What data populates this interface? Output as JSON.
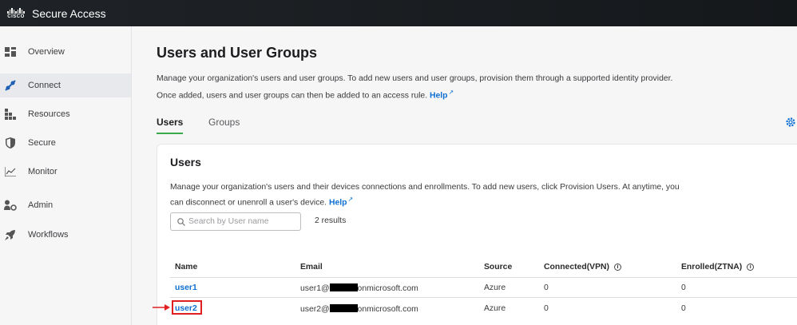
{
  "app": {
    "title": "Secure Access",
    "logo_text": "CISCO"
  },
  "sidebar": {
    "items": [
      {
        "label": "Overview",
        "icon": "overview-icon"
      },
      {
        "label": "Connect",
        "icon": "connect-icon",
        "active": true
      },
      {
        "label": "Resources",
        "icon": "resources-icon"
      },
      {
        "label": "Secure",
        "icon": "shield-icon"
      },
      {
        "label": "Monitor",
        "icon": "monitor-chart-icon"
      },
      {
        "label": "Admin",
        "icon": "admin-user-gear-icon"
      },
      {
        "label": "Workflows",
        "icon": "rocket-icon"
      }
    ]
  },
  "page": {
    "title": "Users and User Groups",
    "desc1": "Manage your organization's users and user groups. To add new users and user groups, provision them through a supported identity provider.",
    "desc2": "Once added, users and user groups can then be added to an access rule.",
    "help": "Help"
  },
  "tabs": [
    {
      "label": "Users",
      "active": true
    },
    {
      "label": "Groups",
      "active": false
    }
  ],
  "card": {
    "title": "Users",
    "desc1": "Manage your organization's users and their devices connections and enrollments. To add new users, click Provision Users. At anytime, you",
    "desc2": "can disconnect or unenroll a user's device.",
    "help": "Help",
    "search_placeholder": "Search by User name",
    "results": "2 results"
  },
  "table": {
    "headers": [
      "Name",
      "Email",
      "Source",
      "Connected(VPN)",
      "Enrolled(ZTNA)"
    ],
    "info_glyph": "i",
    "rows": [
      {
        "name": "user1",
        "email_prefix": "user1@",
        "email_suffix": "onmicrosoft.com",
        "source": "Azure",
        "connected": "0",
        "enrolled": "0"
      },
      {
        "name": "user2",
        "email_prefix": "user2@",
        "email_suffix": "onmicrosoft.com",
        "source": "Azure",
        "connected": "0",
        "enrolled": "0"
      }
    ]
  },
  "colors": {
    "accent": "#0d6fd2",
    "tab_underline": "#3aa94a",
    "highlight": "#e02020",
    "topbar": "#1f2327"
  }
}
